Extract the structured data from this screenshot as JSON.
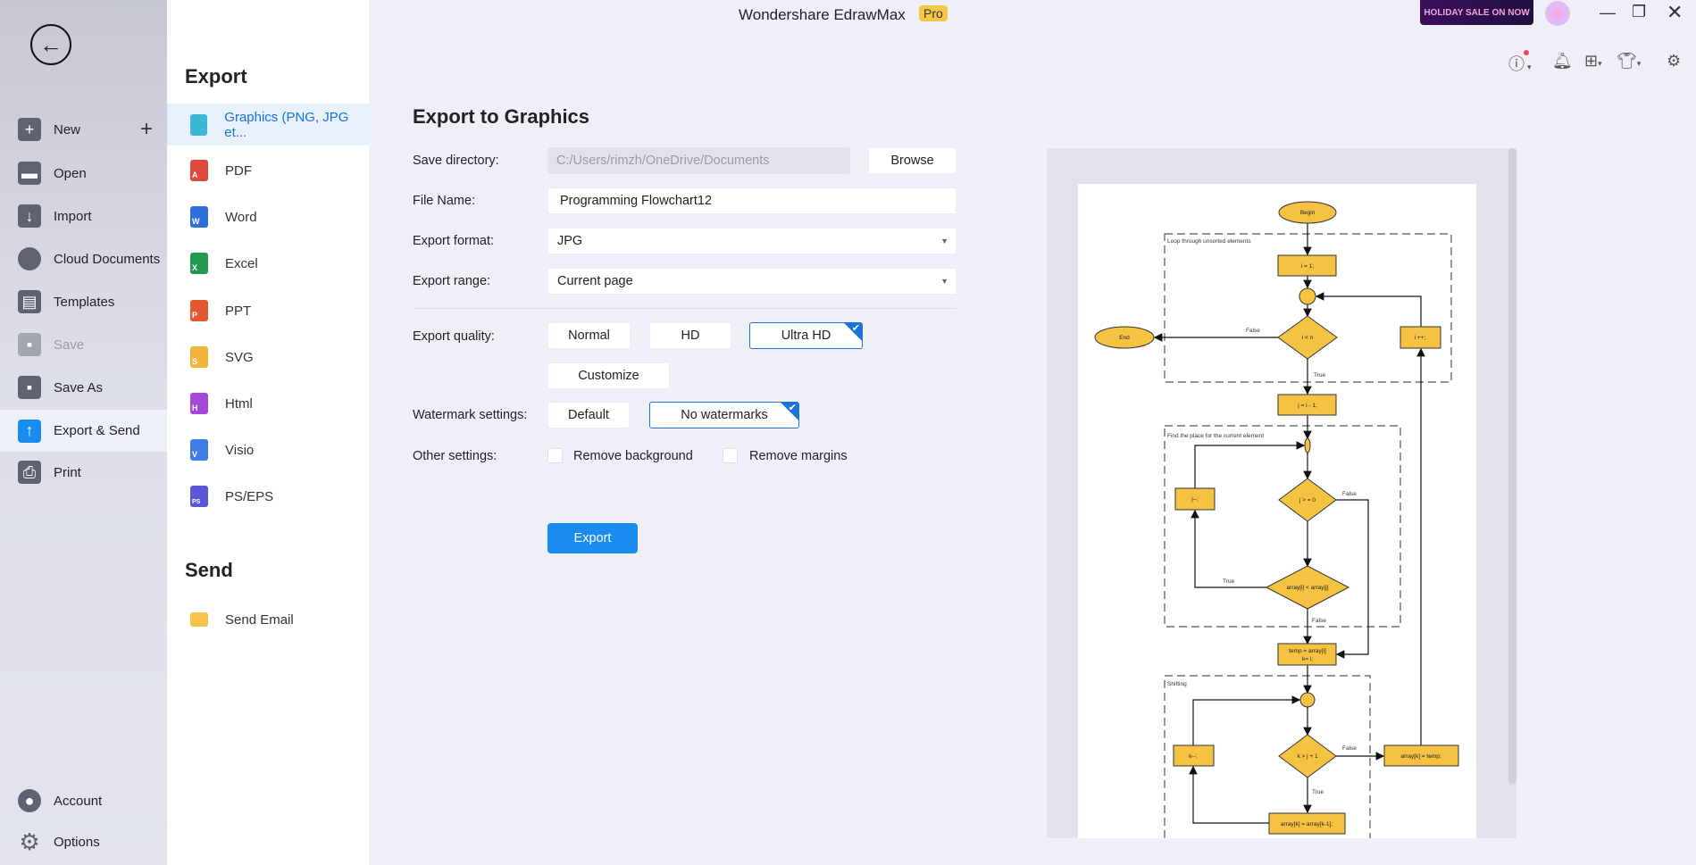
{
  "app": {
    "title": "Wondershare EdrawMax",
    "badge": "Pro",
    "promo": "HOLIDAY SALE ON NOW"
  },
  "colors": {
    "accent": "#1a73d9",
    "export_button": "#1a8cf0",
    "flow_fill": "#f5c242",
    "badge": "#f6c744"
  },
  "sidebar": {
    "items": [
      {
        "label": "New",
        "icon": "plus-square-icon"
      },
      {
        "label": "Open",
        "icon": "folder-icon"
      },
      {
        "label": "Import",
        "icon": "import-icon"
      },
      {
        "label": "Cloud Documents",
        "icon": "cloud-icon"
      },
      {
        "label": "Templates",
        "icon": "templates-icon"
      },
      {
        "label": "Save",
        "icon": "save-icon",
        "disabled": true
      },
      {
        "label": "Save As",
        "icon": "save-as-icon"
      },
      {
        "label": "Export & Send",
        "icon": "export-icon",
        "active": true
      },
      {
        "label": "Print",
        "icon": "printer-icon"
      }
    ],
    "bottom": [
      {
        "label": "Account",
        "icon": "account-icon"
      },
      {
        "label": "Options",
        "icon": "gear-icon"
      }
    ]
  },
  "export_list": {
    "heading": "Export",
    "items": [
      {
        "label": "Graphics (PNG, JPG et...",
        "badge": ""
      },
      {
        "label": "PDF",
        "badge": "A"
      },
      {
        "label": "Word",
        "badge": "W"
      },
      {
        "label": "Excel",
        "badge": "X"
      },
      {
        "label": "PPT",
        "badge": "P"
      },
      {
        "label": "SVG",
        "badge": "S"
      },
      {
        "label": "Html",
        "badge": "H"
      },
      {
        "label": "Visio",
        "badge": "V"
      },
      {
        "label": "PS/EPS",
        "badge": "PS"
      }
    ],
    "send_heading": "Send",
    "send_items": [
      {
        "label": "Send Email"
      }
    ]
  },
  "form": {
    "title": "Export to Graphics",
    "save_dir_label": "Save directory:",
    "save_dir_value": "C:/Users/rimzh/OneDrive/Documents",
    "browse": "Browse",
    "file_name_label": "File Name:",
    "file_name_value": "Programming Flowchart12",
    "format_label": "Export format:",
    "format_value": "JPG",
    "range_label": "Export range:",
    "range_value": "Current page",
    "quality_label": "Export quality:",
    "quality_options": [
      "Normal",
      "HD",
      "Ultra HD"
    ],
    "quality_selected": "Ultra HD",
    "customize": "Customize",
    "watermark_label": "Watermark settings:",
    "watermark_options": [
      "Default",
      "No watermarks"
    ],
    "watermark_selected": "No watermarks",
    "other_label": "Other settings:",
    "remove_background": "Remove background",
    "remove_margins": "Remove margins",
    "export_button": "Export"
  },
  "preview": {
    "groups": [
      "Loop through unsorted elements",
      "Find the place for the current element",
      "Shifting"
    ],
    "nodes": {
      "begin": "Begin",
      "end": "End",
      "i_init": "i = 1;",
      "i_lt_n": "i < n",
      "i_inc": "i ++;",
      "j_init": "j = i - 1;",
      "j_ge_0": "j > = 0",
      "j_dec": "j--;",
      "cmp": "array[i] < array[j]",
      "temp1": "temp = array[i]",
      "temp2": "k= i;",
      "k_gt": "k > j + 1",
      "k_dec": "k--;",
      "shift": "array[k] = array[k-1];",
      "assign": "array[k] = temp;"
    },
    "edge_labels": {
      "t": "True",
      "f": "False"
    }
  }
}
